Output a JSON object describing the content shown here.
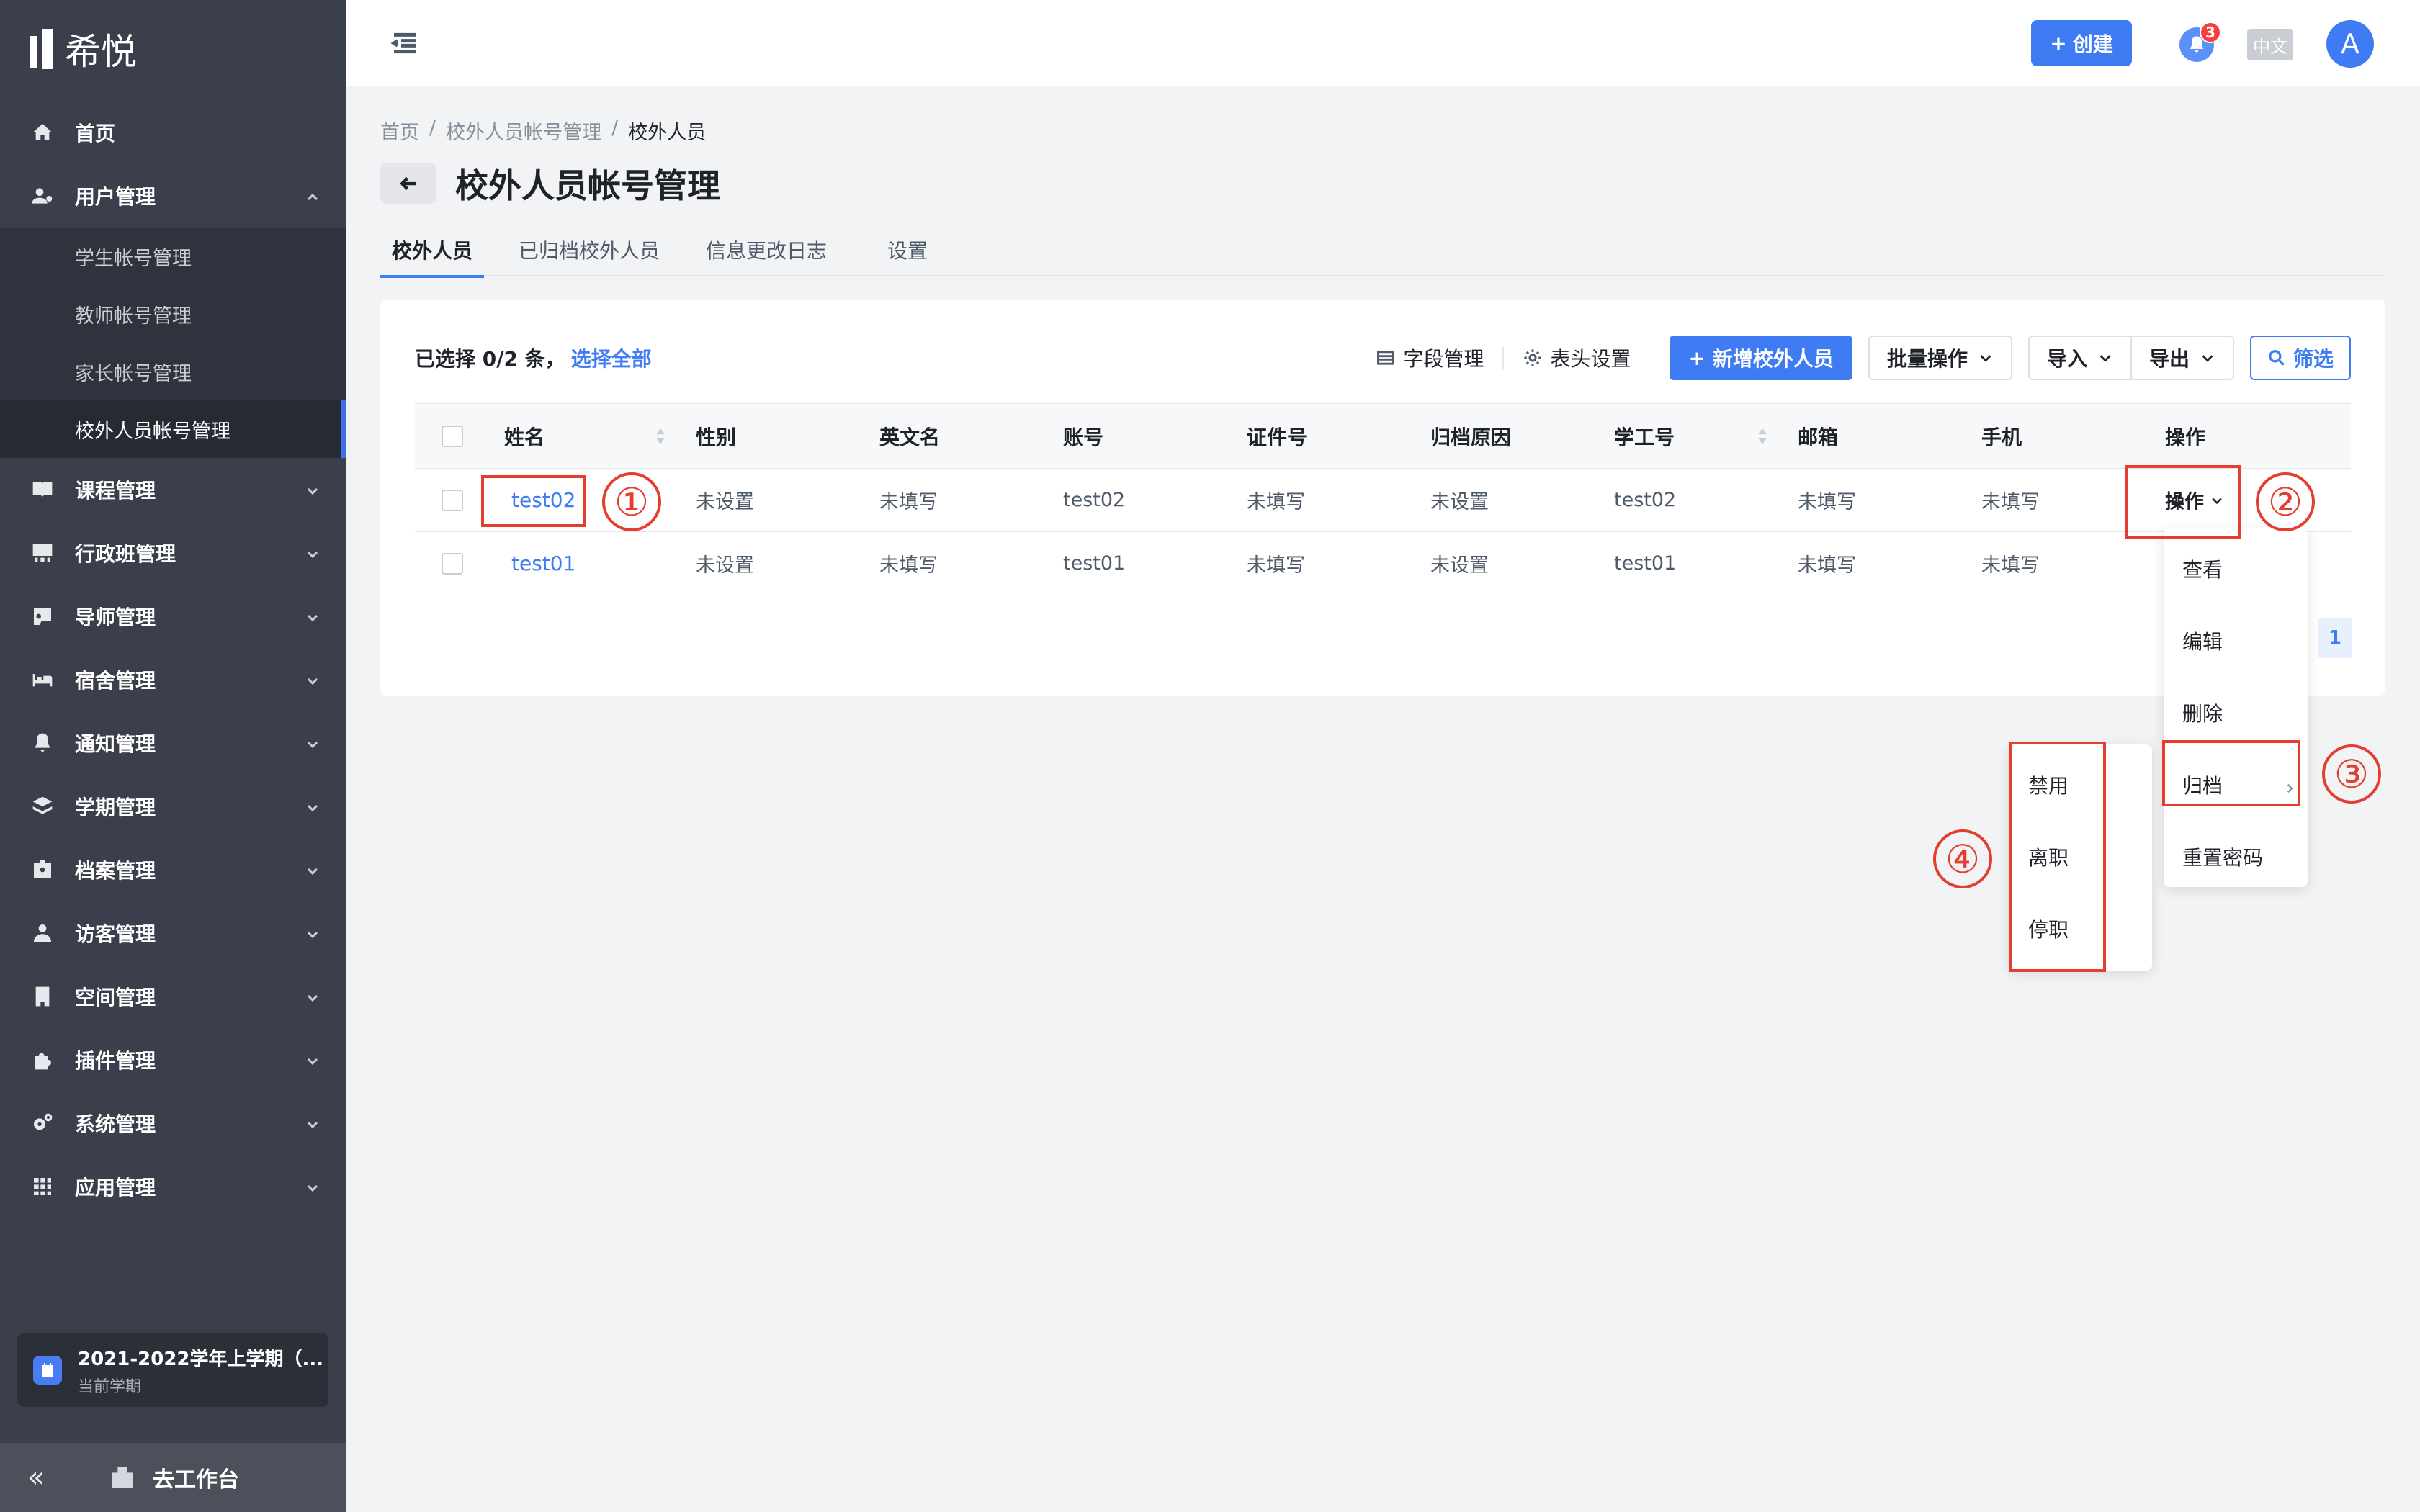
{
  "app": {
    "logo_text": "希悦"
  },
  "sidebar": {
    "items": [
      {
        "label": "首页",
        "icon": "home-icon"
      },
      {
        "label": "用户管理",
        "icon": "user-settings-icon",
        "expanded": true,
        "children": [
          "学生帐号管理",
          "教师帐号管理",
          "家长帐号管理",
          "校外人员帐号管理"
        ],
        "active_child": "校外人员帐号管理"
      },
      {
        "label": "课程管理",
        "icon": "book-icon"
      },
      {
        "label": "行政班管理",
        "icon": "class-icon"
      },
      {
        "label": "导师管理",
        "icon": "mentor-icon"
      },
      {
        "label": "宿舍管理",
        "icon": "bed-icon"
      },
      {
        "label": "通知管理",
        "icon": "bell-icon"
      },
      {
        "label": "学期管理",
        "icon": "layers-icon"
      },
      {
        "label": "档案管理",
        "icon": "id-badge-icon"
      },
      {
        "label": "访客管理",
        "icon": "visitor-icon"
      },
      {
        "label": "空间管理",
        "icon": "building-icon"
      },
      {
        "label": "插件管理",
        "icon": "puzzle-icon"
      },
      {
        "label": "系统管理",
        "icon": "cogs-icon"
      },
      {
        "label": "应用管理",
        "icon": "grid-icon"
      }
    ],
    "term": {
      "title": "2021-2022学年上学期（...",
      "subtitle": "当前学期"
    },
    "collapse_label": "«",
    "workspace_label": "去工作台"
  },
  "topbar": {
    "create_label": "创建",
    "notification_count": "3",
    "lang_label": "中文",
    "avatar_letter": "A"
  },
  "breadcrumb": {
    "items": [
      "首页",
      "校外人员帐号管理",
      "校外人员"
    ],
    "separator": "/"
  },
  "page": {
    "title": "校外人员帐号管理"
  },
  "tabs": [
    "校外人员",
    "已归档校外人员",
    "信息更改日志",
    "设置"
  ],
  "toolbar": {
    "selection_text": "已选择 0/2 条，",
    "select_all_label": "选择全部",
    "field_manage_label": "字段管理",
    "header_settings_label": "表头设置",
    "add_label": "新增校外人员",
    "batch_label": "批量操作",
    "import_label": "导入",
    "export_label": "导出",
    "filter_label": "筛选"
  },
  "table": {
    "columns": [
      "姓名",
      "性别",
      "英文名",
      "账号",
      "证件号",
      "归档原因",
      "学工号",
      "邮箱",
      "手机",
      "操作"
    ],
    "rows": [
      [
        "test02",
        "未设置",
        "未填写",
        "test02",
        "未填写",
        "未设置",
        "test02",
        "未填写",
        "未填写",
        "操作"
      ],
      [
        "test01",
        "未设置",
        "未填写",
        "test01",
        "未填写",
        "未设置",
        "test01",
        "未填写",
        "未填写",
        ""
      ]
    ]
  },
  "pagination": {
    "current": "1"
  },
  "action_menu": {
    "items": [
      "查看",
      "编辑",
      "删除",
      "归档",
      "重置密码"
    ]
  },
  "archive_submenu": {
    "items": [
      "禁用",
      "离职",
      "停职"
    ]
  },
  "annotations": {
    "n1": "①",
    "n2": "②",
    "n3": "③",
    "n4": "④"
  },
  "colors": {
    "accent": "#3f7cf3",
    "sidebar": "#3a3f4b",
    "highlight": "#e53d2f"
  }
}
